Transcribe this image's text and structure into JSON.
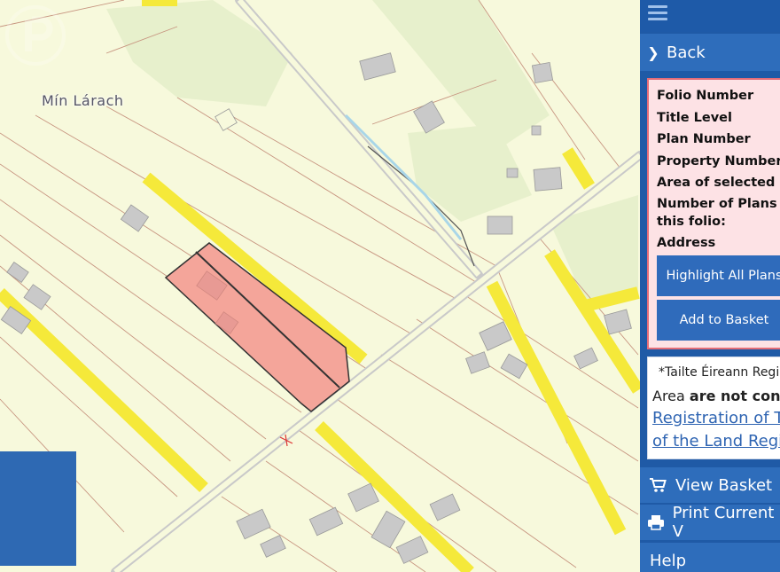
{
  "map": {
    "place_label": "Mín Lárach"
  },
  "panel": {
    "back_label": "Back",
    "info": {
      "folio_number": "Folio Number",
      "title_level": "Title Level",
      "plan_number": "Plan Number",
      "property_number": "Property Number",
      "area_selected": "Area of selected pla",
      "num_plans_line1": "Number of Plans or",
      "num_plans_line2": "this folio:",
      "address": "Address"
    },
    "highlight_button": "Highlight All Plans",
    "basket_button": "Add to Basket",
    "notice": {
      "line1": "*Tailte Éireann Regi",
      "line2_prefix": "Area ",
      "line2_bold": "are not conclu",
      "link_line1": "Registration of Tit",
      "link_line2": "of the Land Regis"
    },
    "view_basket": "View Basket",
    "print_current": "Print Current V",
    "help": "Help"
  },
  "colors": {
    "panel_bg": "#1f5aa6",
    "panel_item": "#2e6dbb",
    "info_bg": "#fde2e5",
    "info_border": "#e46d78",
    "parcel_fill": "#f4a59a",
    "road_yellow": "#f5e93a",
    "map_bg": "#f7f9dc"
  }
}
